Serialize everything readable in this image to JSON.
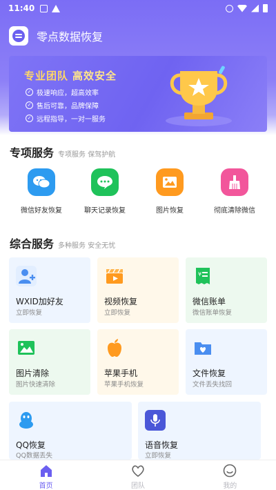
{
  "status_bar": {
    "time": "11:40"
  },
  "app": {
    "title": "零点数据恢复"
  },
  "banner": {
    "headline_a": "专业团队",
    "headline_b": "高效安全",
    "lines": [
      "极速响应，超高效率",
      "售后可靠，品牌保障",
      "远程指导，一对一服务"
    ]
  },
  "special": {
    "title": "专项服务",
    "subtitle": "专项服务 保驾护航",
    "items": [
      {
        "label": "微信好友恢复",
        "icon": "wechat-icon",
        "color": "#2d9bf0"
      },
      {
        "label": "聊天记录恢复",
        "icon": "chat-bubble-icon",
        "color": "#1fc25a"
      },
      {
        "label": "图片恢复",
        "icon": "image-icon",
        "color": "#ff9a1f"
      },
      {
        "label": "彻底清除微信",
        "icon": "broom-icon",
        "color": "#f2569b"
      }
    ]
  },
  "general": {
    "title": "综合服务",
    "subtitle": "多种服务 安全无忧",
    "cards": [
      {
        "title": "WXID加好友",
        "sub": "立即恢复",
        "icon": "add-user-icon"
      },
      {
        "title": "视频恢复",
        "sub": "立即恢复",
        "icon": "video-clapper-icon"
      },
      {
        "title": "微信账单",
        "sub": "微信账单恢复",
        "icon": "bill-icon"
      },
      {
        "title": "图片清除",
        "sub": "图片快速清除",
        "icon": "picture-icon"
      },
      {
        "title": "苹果手机",
        "sub": "苹果手机恢复",
        "icon": "apple-icon"
      },
      {
        "title": "文件恢复",
        "sub": "文件丢失找回",
        "icon": "folder-heart-icon"
      },
      {
        "title": "QQ恢复",
        "sub": "QQ数据丢失",
        "icon": "qq-penguin-icon"
      },
      {
        "title": "语音恢复",
        "sub": "立即恢复",
        "icon": "microphone-icon"
      }
    ]
  },
  "tabs": [
    {
      "label": "首页",
      "icon": "home-icon",
      "active": true
    },
    {
      "label": "团队",
      "icon": "heart-icon",
      "active": false
    },
    {
      "label": "我的",
      "icon": "profile-icon",
      "active": false
    }
  ],
  "colors": {
    "accent": "#7b6df5",
    "tab_active": "#6b5ff0",
    "tab_inactive": "#b9b9c0"
  }
}
